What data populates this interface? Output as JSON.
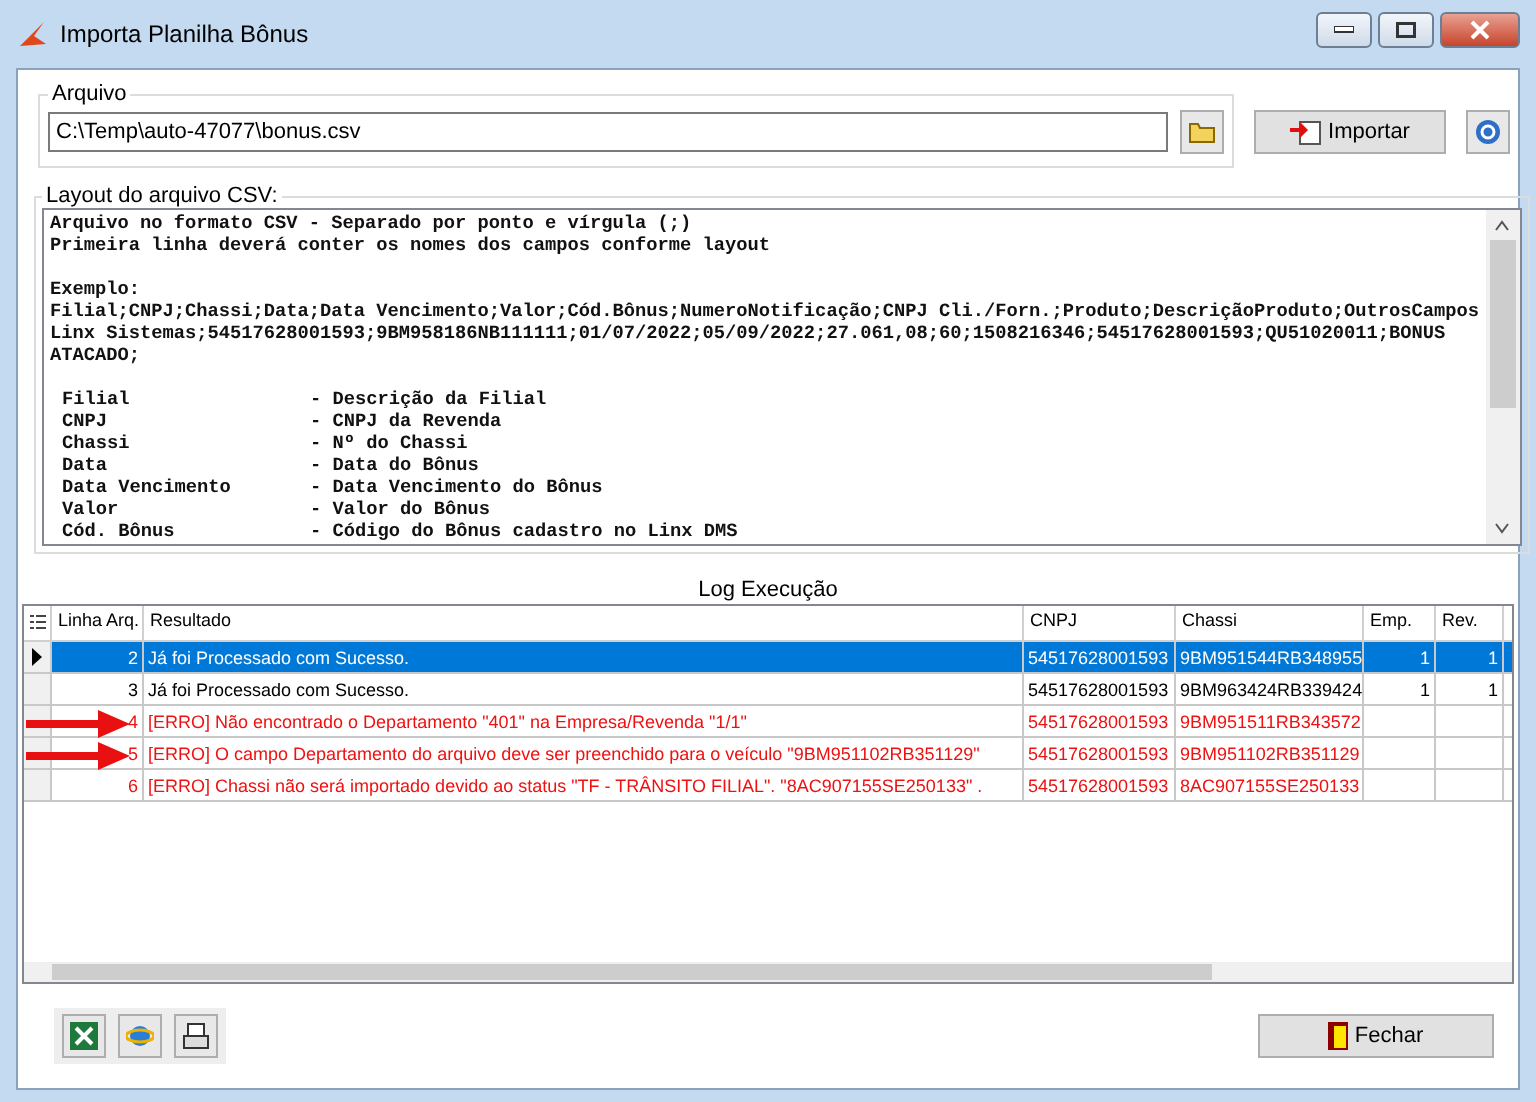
{
  "window": {
    "title": "Importa Planilha Bônus"
  },
  "file_group": {
    "label": "Arquivo",
    "path": "C:\\Temp\\auto-47077\\bonus.csv",
    "import_button": "Importar"
  },
  "layout_group": {
    "label": "Layout do arquivo CSV:",
    "paragraphs": [
      [
        "Arquivo no formato CSV - Separado por ponto e vírgula (;)",
        "Primeira linha deverá conter os nomes dos campos conforme layout"
      ],
      [
        "Exemplo:",
        "Filial;CNPJ;Chassi;Data;Data Vencimento;Valor;Cód.Bônus;NumeroNotificação;CNPJ Cli./Forn.;Produto;DescriçãoProduto;OutrosCampos",
        "Linx Sistemas;54517628001593;9BM958186NB111111;01/07/2022;05/09/2022;27.061,08;60;1508216346;54517628001593;QU51020011;BONUS",
        "ATACADO;"
      ]
    ],
    "fields": [
      {
        "name": "Filial",
        "description": "- Descrição da Filial"
      },
      {
        "name": "CNPJ",
        "description": "- CNPJ da Revenda"
      },
      {
        "name": "Chassi",
        "description": "- Nº do Chassi"
      },
      {
        "name": "Data",
        "description": "- Data do Bônus"
      },
      {
        "name": "Data Vencimento",
        "description": "- Data Vencimento do Bônus"
      },
      {
        "name": "Valor",
        "description": "- Valor do Bônus"
      },
      {
        "name": "Cód. Bônus",
        "description": "- Código do Bônus cadastro no Linx DMS"
      }
    ]
  },
  "log": {
    "title": "Log Execução",
    "columns": [
      "Linha Arq.",
      "Resultado",
      "CNPJ",
      "Chassi",
      "Emp.",
      "Rev."
    ],
    "rows": [
      {
        "selected": true,
        "kind": "ok",
        "arrow": false,
        "cells": [
          "2",
          "Já foi Processado com Sucesso.",
          "54517628001593",
          "9BM951544RB348955",
          "1",
          "1"
        ]
      },
      {
        "selected": false,
        "kind": "ok",
        "arrow": false,
        "cells": [
          "3",
          "Já foi Processado com Sucesso.",
          "54517628001593",
          "9BM963424RB339424",
          "1",
          "1"
        ]
      },
      {
        "selected": false,
        "kind": "error",
        "arrow": true,
        "cells": [
          "4",
          "[ERRO] Não encontrado o Departamento \"401\" na Empresa/Revenda \"1/1\"",
          "54517628001593",
          "9BM951511RB343572",
          "",
          ""
        ]
      },
      {
        "selected": false,
        "kind": "error",
        "arrow": true,
        "cells": [
          "5",
          "[ERRO] O campo Departamento do arquivo deve ser preenchido para o veículo \"9BM951102RB351129\"",
          "54517628001593",
          "9BM951102RB351129",
          "",
          ""
        ]
      },
      {
        "selected": false,
        "kind": "error",
        "arrow": false,
        "cells": [
          "6",
          "[ERRO] Chassi não será importado devido ao status \"TF - TRÂNSITO FILIAL\". \"8AC907155SE250133\" .",
          "54517628001593",
          "8AC907155SE250133",
          "",
          ""
        ]
      }
    ]
  },
  "close_button": "Fechar"
}
